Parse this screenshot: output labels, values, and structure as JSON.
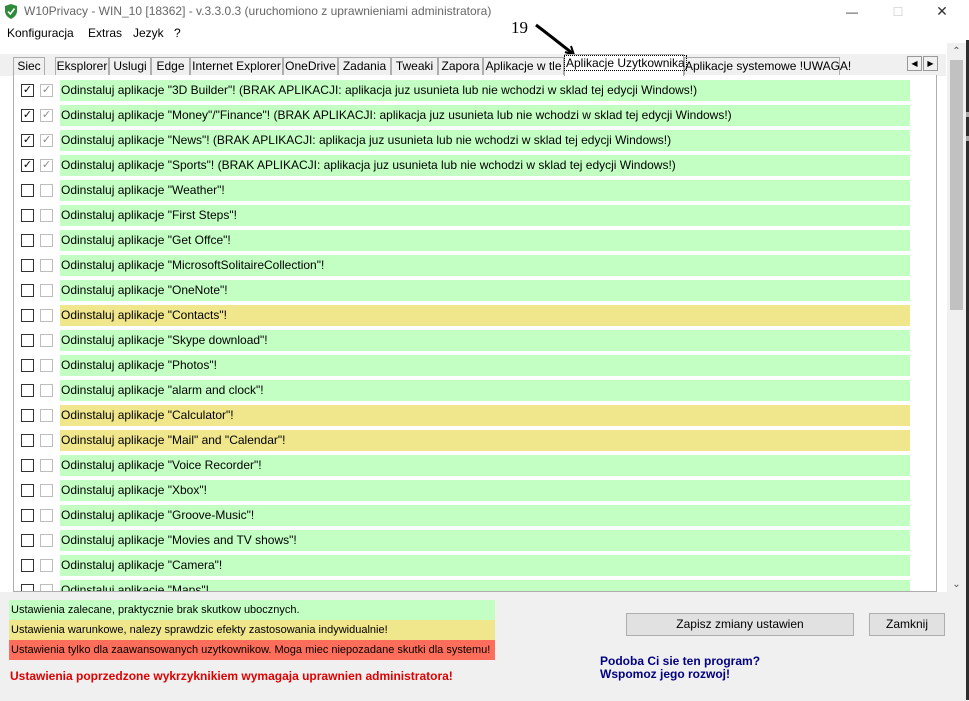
{
  "window": {
    "title": "W10Privacy - WIN_10 [18362]  - v.3.3.0.3 (uruchomiono z uprawnieniami administratora)",
    "minimize_glyph": "—",
    "maximize_glyph": "☐",
    "close_glyph": "✕"
  },
  "menu": [
    "Konfiguracja",
    "Extras",
    "Jezyk",
    "?"
  ],
  "annotation": {
    "label": "19"
  },
  "tabs": [
    {
      "label": "Siec"
    },
    {
      "label": "Eksplorer"
    },
    {
      "label": "Uslugi"
    },
    {
      "label": "Edge"
    },
    {
      "label": "Internet Explorer"
    },
    {
      "label": "OneDrive"
    },
    {
      "label": "Zadania"
    },
    {
      "label": "Tweaki"
    },
    {
      "label": "Zapora"
    },
    {
      "label": "Aplikacje w tle"
    },
    {
      "label": "Aplikacje Uzytkownika",
      "active": true
    },
    {
      "label": "Aplikacje systemowe !UWAGA!"
    }
  ],
  "tab_scroll": {
    "left": "◀",
    "right": "▶"
  },
  "colors": {
    "green": "#c3ffc3",
    "yellow": "#f0e68c",
    "red": "#ff6e5a",
    "link": "#000080",
    "warning_text": "#e00000"
  },
  "rows": [
    {
      "text": "Odinstaluj aplikacje \"3D Builder\"! (BRAK APLIKACJI: aplikacja juz usunieta lub nie wchodzi w sklad tej edycji Windows!)",
      "checked": true,
      "level": "green"
    },
    {
      "text": "Odinstaluj aplikacje \"Money\"/\"Finance\"! (BRAK APLIKACJI: aplikacja juz usunieta lub nie wchodzi w sklad tej edycji Windows!)",
      "checked": true,
      "level": "green"
    },
    {
      "text": "Odinstaluj aplikacje \"News\"! (BRAK APLIKACJI: aplikacja juz usunieta lub nie wchodzi w sklad tej edycji Windows!)",
      "checked": true,
      "level": "green"
    },
    {
      "text": "Odinstaluj aplikacje \"Sports\"! (BRAK APLIKACJI: aplikacja juz usunieta lub nie wchodzi w sklad tej edycji Windows!)",
      "checked": true,
      "level": "green"
    },
    {
      "text": "Odinstaluj aplikacje \"Weather\"!",
      "checked": false,
      "level": "green"
    },
    {
      "text": "Odinstaluj aplikacje \"First Steps\"!",
      "checked": false,
      "level": "green"
    },
    {
      "text": "Odinstaluj aplikacje \"Get Offce\"!",
      "checked": false,
      "level": "green"
    },
    {
      "text": "Odinstaluj aplikacje \"MicrosoftSolitaireCollection\"!",
      "checked": false,
      "level": "green"
    },
    {
      "text": "Odinstaluj aplikacje \"OneNote\"!",
      "checked": false,
      "level": "green"
    },
    {
      "text": "Odinstaluj aplikacje \"Contacts\"!",
      "checked": false,
      "level": "yellow"
    },
    {
      "text": "Odinstaluj aplikacje \"Skype download\"!",
      "checked": false,
      "level": "green"
    },
    {
      "text": "Odinstaluj aplikacje \"Photos\"!",
      "checked": false,
      "level": "green"
    },
    {
      "text": "Odinstaluj aplikacje \"alarm and clock\"!",
      "checked": false,
      "level": "green"
    },
    {
      "text": "Odinstaluj aplikacje \"Calculator\"!",
      "checked": false,
      "level": "yellow"
    },
    {
      "text": "Odinstaluj aplikacje \"Mail\" and \"Calendar\"!",
      "checked": false,
      "level": "yellow"
    },
    {
      "text": "Odinstaluj aplikacje \"Voice Recorder\"!",
      "checked": false,
      "level": "green"
    },
    {
      "text": "Odinstaluj aplikacje \"Xbox\"!",
      "checked": false,
      "level": "green"
    },
    {
      "text": "Odinstaluj aplikacje \"Groove-Music\"!",
      "checked": false,
      "level": "green"
    },
    {
      "text": "Odinstaluj aplikacje \"Movies and TV shows\"!",
      "checked": false,
      "level": "green"
    },
    {
      "text": "Odinstaluj aplikacje \"Camera\"!",
      "checked": false,
      "level": "green"
    },
    {
      "text": "Odinstaluj aplikacje \"Maps\"!",
      "checked": false,
      "level": "green"
    }
  ],
  "scrollbar": {
    "up": "⌃",
    "down": "⌄"
  },
  "legend": {
    "green": "Ustawienia zalecane, praktycznie brak skutkow ubocznych.",
    "yellow": "Ustawienia warunkowe, nalezy sprawdzic efekty zastosowania indywidualnie!",
    "red": "Ustawienia tylko dla zaawansowanych uzytkownikow. Moga miec niepozadane skutki dla systemu!"
  },
  "buttons": {
    "save": "Zapisz zmiany ustawien",
    "close": "Zamknij"
  },
  "footer": {
    "warning": "Ustawienia poprzedzone wykrzyknikiem wymagaja uprawnien administratora!",
    "link1": "Podoba Ci sie ten program?",
    "link2": "Wspomoz jego rozwoj!"
  }
}
